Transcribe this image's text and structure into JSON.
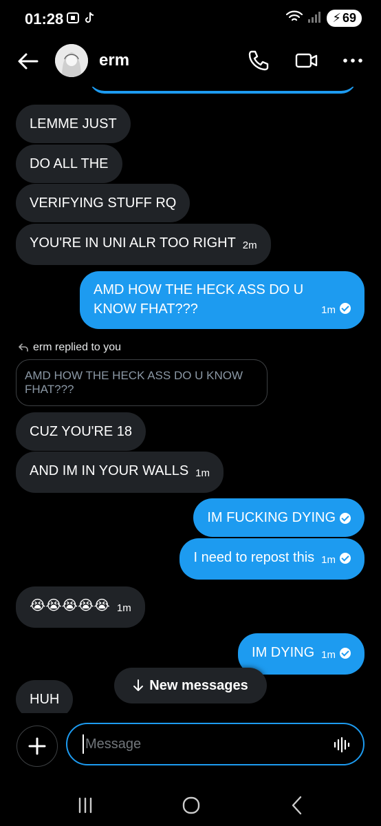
{
  "status_bar": {
    "time": "01:28",
    "battery": "69"
  },
  "header": {
    "contact_name": "erm"
  },
  "messages": [
    {
      "text": "LEMME JUST",
      "time": ""
    },
    {
      "text": "DO ALL THE",
      "time": ""
    },
    {
      "text": "VERIFYING STUFF RQ",
      "time": ""
    },
    {
      "text": "YOU'RE IN UNI ALR TOO RIGHT",
      "time": "2m"
    },
    {
      "line1": "AMD HOW THE HECK ASS DO U",
      "line2": "KNOW FHAT???",
      "time": "1m"
    },
    {
      "reply_label": "erm replied to you",
      "quoted_text": "AMD HOW THE HECK ASS DO U KNOW FHAT???"
    },
    {
      "text": "CUZ YOU'RE 18",
      "time": ""
    },
    {
      "text": "AND IM IN YOUR WALLS",
      "time": "1m"
    },
    {
      "text": "IM FUCKING DYING",
      "time": ""
    },
    {
      "text": "I need to repost this",
      "time": "1m"
    },
    {
      "text": "😭😭😭😭😭",
      "time": "1m"
    },
    {
      "text": "IM DYING",
      "time": "1m"
    },
    {
      "text": "HUH",
      "time": ""
    }
  ],
  "new_messages_label": "New messages",
  "composer": {
    "placeholder": "Message"
  },
  "colors": {
    "accent": "#1d9bf0",
    "incoming_bubble": "#202327",
    "background": "#000000"
  }
}
